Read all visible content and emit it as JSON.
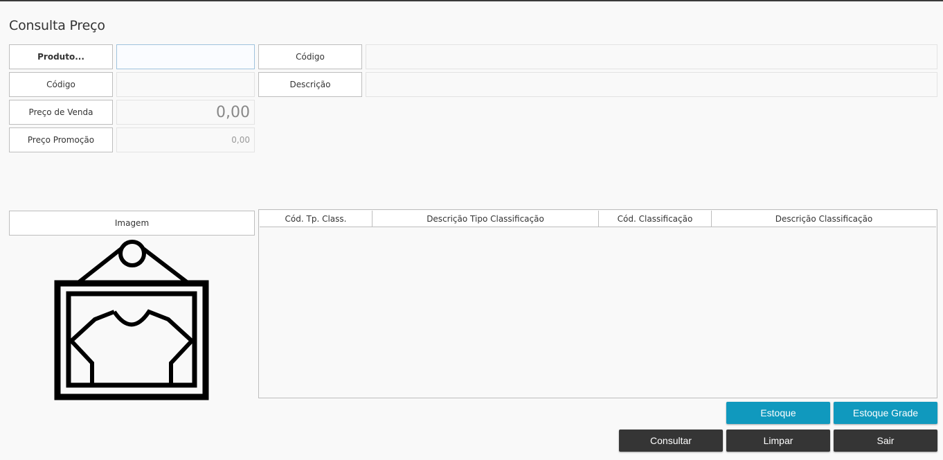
{
  "page": {
    "title": "Consulta Preço"
  },
  "form": {
    "produto_label": "Produto...",
    "produto_value": "",
    "codigo_top_label": "Código",
    "codigo_top_value": "",
    "codigo_label": "Código",
    "codigo_value": "",
    "descricao_label": "Descrição",
    "descricao_value": "",
    "preco_venda_label": "Preço de Venda",
    "preco_venda_value": "0,00",
    "preco_promocao_label": "Preço Promoção",
    "preco_promocao_value": "0,00"
  },
  "image": {
    "label": "Imagem",
    "icon": "product-tag-shirt-icon"
  },
  "grid": {
    "columns": [
      "Cód. Tp. Class.",
      "Descrição Tipo Classificação",
      "Cód. Classificação",
      "Descrição Classificação"
    ],
    "rows": []
  },
  "buttons": {
    "estoque": "Estoque",
    "estoque_grade": "Estoque Grade",
    "consultar": "Consultar",
    "limpar": "Limpar",
    "sair": "Sair"
  },
  "colors": {
    "primary_button": "#1099be",
    "dark_button": "#353535",
    "active_border": "#9fc3dd"
  }
}
